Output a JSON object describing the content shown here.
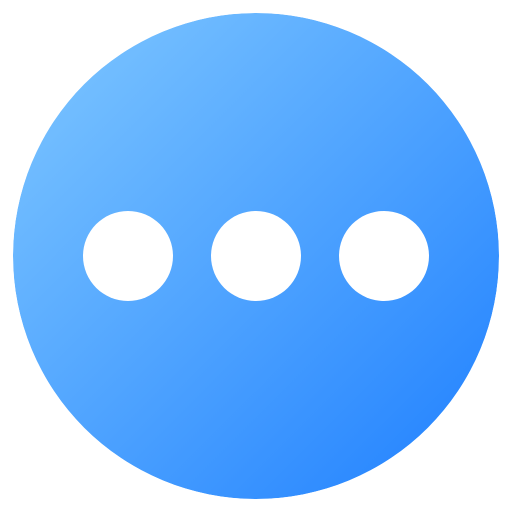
{
  "icon": {
    "name": "more-options-icon",
    "dot_count": 3,
    "colors": {
      "gradient_start": "#80C8FF",
      "gradient_end": "#1E7FFF",
      "dot": "#FFFFFF"
    }
  }
}
